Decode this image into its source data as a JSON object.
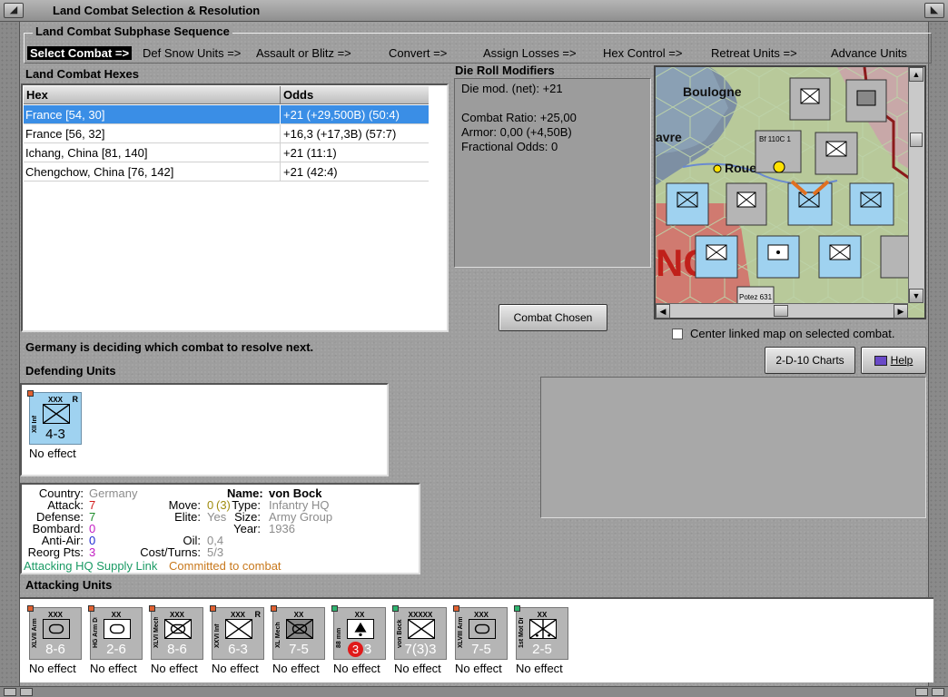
{
  "window": {
    "title": "Land Combat Selection & Resolution",
    "min_glyph": "◢",
    "close_glyph": "◣"
  },
  "phases": {
    "legend": "Land Combat Subphase Sequence",
    "steps": [
      "Select Combat =>",
      "Def Snow Units =>",
      "Assault or Blitz =>",
      "Convert =>",
      "Assign Losses =>",
      "Hex Control =>",
      "Retreat Units =>",
      "Advance Units"
    ]
  },
  "hexes": {
    "label": "Land Combat Hexes",
    "col_hex": "Hex",
    "col_odds": "Odds",
    "rows": [
      {
        "hex": "France [54, 30]",
        "odds": "+21 (+29,500B) (50:4)"
      },
      {
        "hex": "France [56, 32]",
        "odds": "+16,3 (+17,3B) (57:7)"
      },
      {
        "hex": "Ichang, China [81, 140]",
        "odds": "+21 (11:1)"
      },
      {
        "hex": "Chengchow, China [76, 142]",
        "odds": "+21 (42:4)"
      }
    ]
  },
  "drm": {
    "label": "Die Roll Modifiers",
    "net": "Die mod. (net): +21",
    "ratio": "Combat Ratio: +25,00",
    "armor": "Armor: 0,00 (+4,50B)",
    "fractional": "Fractional Odds: 0"
  },
  "buttons": {
    "combat_chosen": "Combat Chosen",
    "charts": "2-D-10 Charts",
    "help": "Help"
  },
  "map": {
    "city1": "Boulogne",
    "city2": "avre",
    "city3": "Roue",
    "big_letters": "NC",
    "aircraft1": "Bf 110C 1",
    "aircraft2": "Potez 631"
  },
  "center_linked": "Center linked map on selected combat.",
  "status": "Germany is deciding which combat to resolve next.",
  "defending": {
    "label": "Defending Units",
    "units": [
      {
        "size": "XXX",
        "side": "XII Inf",
        "str": "4-3",
        "flag": "R",
        "result": "No effect"
      }
    ]
  },
  "info": {
    "country_k": "Country:",
    "country_v": "Germany",
    "attack_k": "Attack:",
    "attack_v": "7",
    "defense_k": "Defense:",
    "defense_v": "7",
    "bombard_k": "Bombard:",
    "bombard_v": "0",
    "antiair_k": "Anti-Air:",
    "antiair_v": "0",
    "reorg_k": "Reorg Pts:",
    "reorg_v": "3",
    "move_k": "Move:",
    "move_v": "0",
    "move_v2": "(3)",
    "elite_k": "Elite:",
    "elite_v": "Yes",
    "oil_k": "Oil:",
    "oil_v": "0,4",
    "cost_k": "Cost/Turns:",
    "cost_v": "5/3",
    "name_k": "Name:",
    "name_v": "von Bock",
    "type_k": "Type:",
    "type_v": "Infantry HQ",
    "size_k": "Size:",
    "size_v": "Army Group",
    "year_k": "Year:",
    "year_v": "1936",
    "supply": "Attacking HQ Supply Link",
    "committed": "Committed to combat"
  },
  "attacking": {
    "label": "Attacking Units",
    "units": [
      {
        "size": "XXX",
        "side": "XLVII Arm",
        "str": "8-6",
        "sym": "armor",
        "result": "No effect"
      },
      {
        "size": "XX",
        "side": "HG Arm Div",
        "str": "2-6",
        "sym": "armor",
        "result": "No effect"
      },
      {
        "size": "XXX",
        "side": "XLVI Mech",
        "str": "8-6",
        "sym": "mech",
        "result": "No effect"
      },
      {
        "size": "XXX",
        "side": "XXVI Inf",
        "str": "6-3",
        "sym": "inf",
        "flag": "R",
        "result": "No effect"
      },
      {
        "size": "XX",
        "side": "XL Mech",
        "str": "7-5",
        "sym": "mech",
        "result": "No effect"
      },
      {
        "size": "XX",
        "side": "88 mm",
        "str": "3",
        "badge": "3",
        "sym": "aa",
        "result": "No effect"
      },
      {
        "size": "XXXXX",
        "side": "von Bock",
        "str": "7(3)3",
        "sym": "inf",
        "result": "No effect"
      },
      {
        "size": "XXX",
        "side": "XLVIII Arm",
        "str": "7-5",
        "sym": "armor",
        "result": "No effect"
      },
      {
        "size": "XX",
        "side": "1st Mot Div",
        "str": "2-5",
        "sym": "mot",
        "result": "No effect"
      }
    ]
  },
  "colors": {
    "selected_row": "#3a8ee6",
    "unit_blue": "#9fd2f0",
    "unit_gray": "#b5b5b5"
  }
}
